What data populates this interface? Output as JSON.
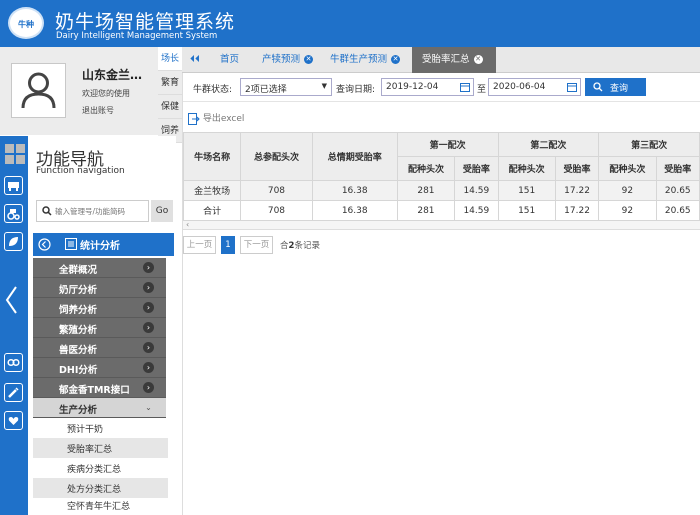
{
  "header": {
    "logo_text": "牛种",
    "title": "奶牛场智能管理系统",
    "subtitle": "Dairy Intelligent Management System"
  },
  "user": {
    "name": "山东金兰…",
    "welcome": "欢迎您的使用",
    "logout": "退出账号"
  },
  "side_tabs": [
    "场长",
    "繁育",
    "保健",
    "饲养"
  ],
  "nav": {
    "title": "功能导航",
    "subtitle": "Function navigation",
    "search_placeholder": "输入管理号/功能简码",
    "go_label": "Go",
    "section": "统计分析",
    "menu": [
      "全群概况",
      "奶厅分析",
      "饲养分析",
      "繁殖分析",
      "兽医分析",
      "DHI分析",
      "郁金香TMR接口",
      "生产分析"
    ],
    "open_menu_arrow": "⌄",
    "sub_items": [
      "预计干奶",
      "受胎率汇总",
      "疾病分类汇总",
      "处方分类汇总",
      "空怀青年牛汇总"
    ]
  },
  "tabs": {
    "home": "首页",
    "items": [
      "产犊预测",
      "牛群生产预测",
      "受胎率汇总"
    ]
  },
  "filters": {
    "herd_status_label": "牛群状态:",
    "herd_status_value": "2项已选择",
    "query_date_label": "查询日期:",
    "date_from": "2019-12-04",
    "to_label": "至",
    "date_to": "2020-06-04",
    "search_label": "查询"
  },
  "export_label": "导出excel",
  "table": {
    "headers": {
      "farm": "牛场名称",
      "total_bred": "总参配头次",
      "total_rate": "总情期受胎率",
      "first": "第一配次",
      "second": "第二配次",
      "third": "第三配次",
      "bred": "配种头次",
      "rate": "受胎率"
    },
    "rows": [
      [
        "金兰牧场",
        "708",
        "16.38",
        "281",
        "14.59",
        "151",
        "17.22",
        "92",
        "20.65"
      ],
      [
        "合计",
        "708",
        "16.38",
        "281",
        "14.59",
        "151",
        "17.22",
        "92",
        "20.65"
      ]
    ]
  },
  "pagination": {
    "prev": "上一页",
    "current": "1",
    "next": "下一页",
    "total_prefix": "合",
    "total_count": "2",
    "total_suffix": "条记录"
  },
  "colors": {
    "primary": "#1f71c9",
    "menu_bg": "#6b6b6b"
  }
}
